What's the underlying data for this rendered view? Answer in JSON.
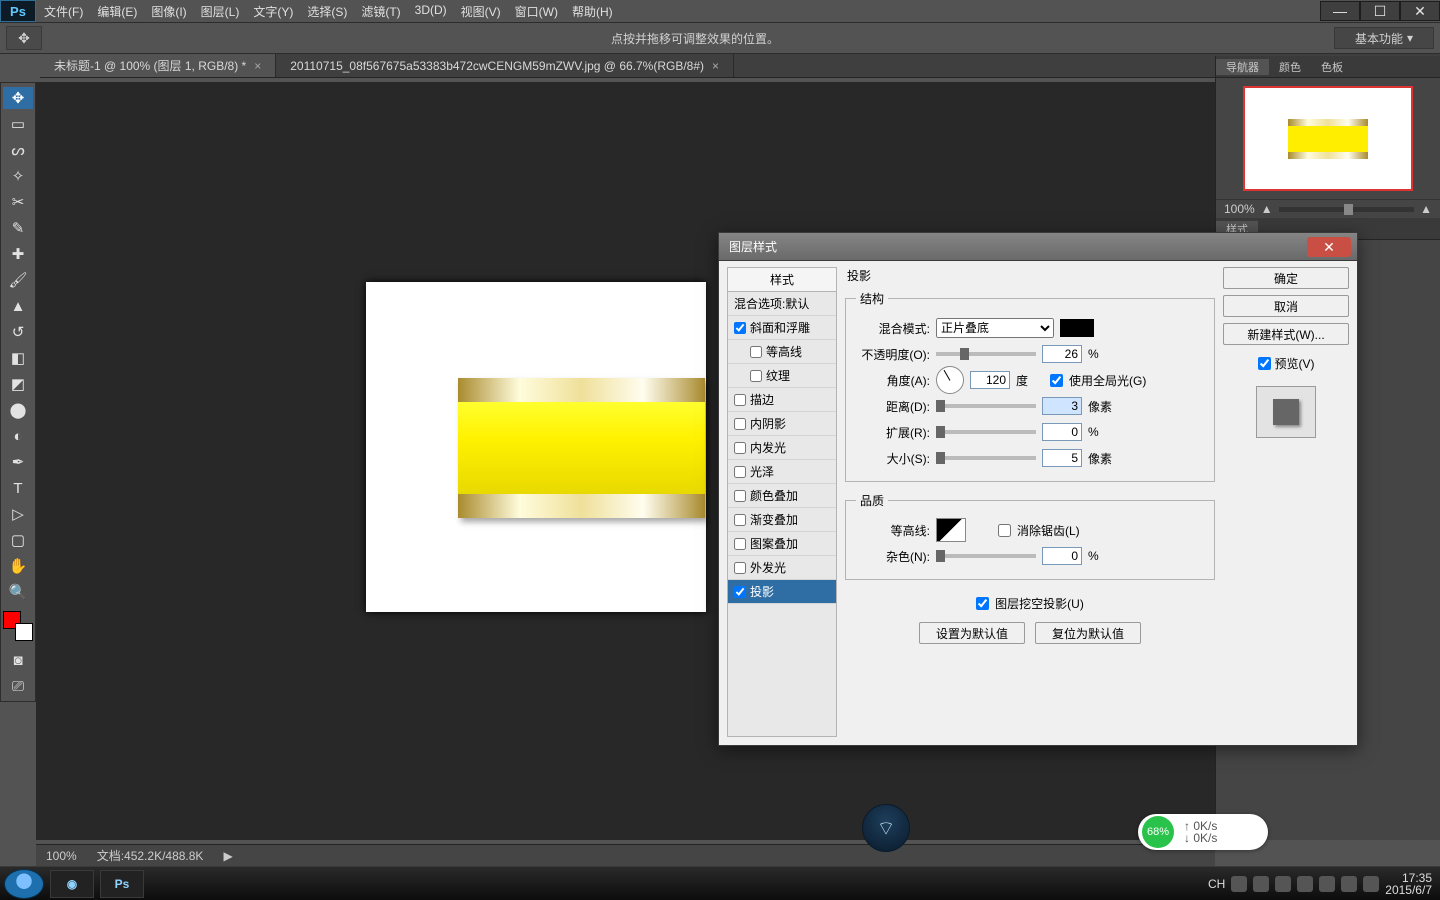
{
  "menubar": [
    "文件(F)",
    "编辑(E)",
    "图像(I)",
    "图层(L)",
    "文字(Y)",
    "选择(S)",
    "滤镜(T)",
    "3D(D)",
    "视图(V)",
    "窗口(W)",
    "帮助(H)"
  ],
  "options": {
    "hint": "点按并拖移可调整效果的位置。",
    "workspace": "基本功能"
  },
  "tabs": [
    {
      "label": "未标题-1 @ 100% (图层 1, RGB/8) *",
      "active": true
    },
    {
      "label": "20110715_08f567675a53383b472cwCENGM59mZWV.jpg @ 66.7%(RGB/8#)",
      "active": false
    }
  ],
  "swatch_fg": "#ff0000",
  "nav": {
    "tabs": [
      "导航器",
      "颜色",
      "色板"
    ],
    "zoom": "100%"
  },
  "style_panel_tab": "样式",
  "status": {
    "zoom": "100%",
    "doc": "文档:452.2K/488.8K"
  },
  "taskbar": {
    "time": "17:35",
    "date": "2015/6/7",
    "ime": "CH"
  },
  "speed": {
    "pct": "68%",
    "up": "0K/s",
    "down": "0K/s"
  },
  "dialog": {
    "title": "图层样式",
    "buttons": {
      "ok": "确定",
      "cancel": "取消",
      "newstyle": "新建样式(W)...",
      "preview": "预览(V)"
    },
    "styles_header": "样式",
    "styles": [
      {
        "label": "混合选项:默认",
        "checked": null
      },
      {
        "label": "斜面和浮雕",
        "checked": true
      },
      {
        "label": "等高线",
        "checked": false,
        "indent": true
      },
      {
        "label": "纹理",
        "checked": false,
        "indent": true
      },
      {
        "label": "描边",
        "checked": false
      },
      {
        "label": "内阴影",
        "checked": false
      },
      {
        "label": "内发光",
        "checked": false
      },
      {
        "label": "光泽",
        "checked": false
      },
      {
        "label": "颜色叠加",
        "checked": false
      },
      {
        "label": "渐变叠加",
        "checked": false
      },
      {
        "label": "图案叠加",
        "checked": false
      },
      {
        "label": "外发光",
        "checked": false
      },
      {
        "label": "投影",
        "checked": true,
        "selected": true
      }
    ],
    "section_title": "投影",
    "group_structure": "结构",
    "group_quality": "品质",
    "labels": {
      "blend": "混合模式:",
      "opacity": "不透明度(O):",
      "angle": "角度(A):",
      "useglobal": "使用全局光(G)",
      "distance": "距离(D):",
      "spread": "扩展(R):",
      "size": "大小(S):",
      "contour": "等高线:",
      "antialias": "消除锯齿(L)",
      "noise": "杂色(N):",
      "knockout": "图层挖空投影(U)",
      "make_default": "设置为默认值",
      "reset_default": "复位为默认值",
      "deg": "度",
      "px": "像素",
      "pct": "%"
    },
    "values": {
      "blend_mode": "正片叠底",
      "color": "#000000",
      "opacity": "26",
      "angle": "120",
      "useglobal": true,
      "distance": "3",
      "spread": "0",
      "size": "5",
      "antialias": false,
      "noise": "0",
      "knockout": true
    }
  }
}
